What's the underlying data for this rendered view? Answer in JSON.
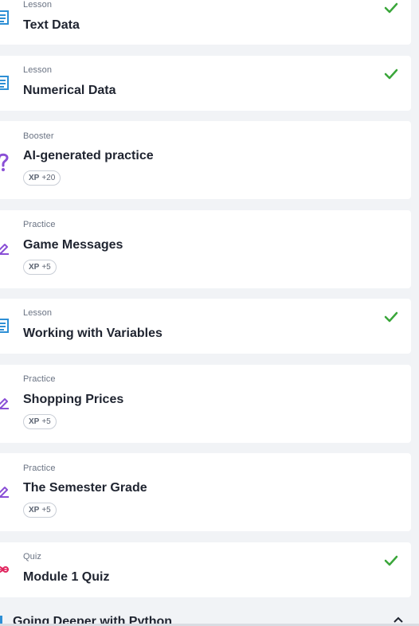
{
  "items": [
    {
      "type": "Lesson",
      "title": "Text Data",
      "completed": true,
      "icon": "lesson-icon"
    },
    {
      "type": "Lesson",
      "title": "Numerical Data",
      "completed": true,
      "icon": "lesson-icon"
    },
    {
      "type": "Booster",
      "title": "AI-generated practice",
      "xp_label": "XP",
      "xp_value": "+20",
      "completed": false,
      "icon": "question-icon"
    },
    {
      "type": "Practice",
      "title": "Game Messages",
      "xp_label": "XP",
      "xp_value": "+5",
      "completed": false,
      "icon": "pencil-icon"
    },
    {
      "type": "Lesson",
      "title": "Working with Variables",
      "completed": true,
      "icon": "lesson-icon"
    },
    {
      "type": "Practice",
      "title": "Shopping Prices",
      "xp_label": "XP",
      "xp_value": "+5",
      "completed": false,
      "icon": "pencil-icon"
    },
    {
      "type": "Practice",
      "title": "The Semester Grade",
      "xp_label": "XP",
      "xp_value": "+5",
      "completed": false,
      "icon": "pencil-icon"
    },
    {
      "type": "Quiz",
      "title": "Module 1 Quiz",
      "completed": true,
      "icon": "quiz-icon"
    }
  ],
  "next_section": {
    "title": "Going Deeper with Python"
  },
  "colors": {
    "lesson": "#2d8fd5",
    "practice": "#8a4fd6",
    "quiz": "#e0245e",
    "check": "#3aa63a"
  }
}
